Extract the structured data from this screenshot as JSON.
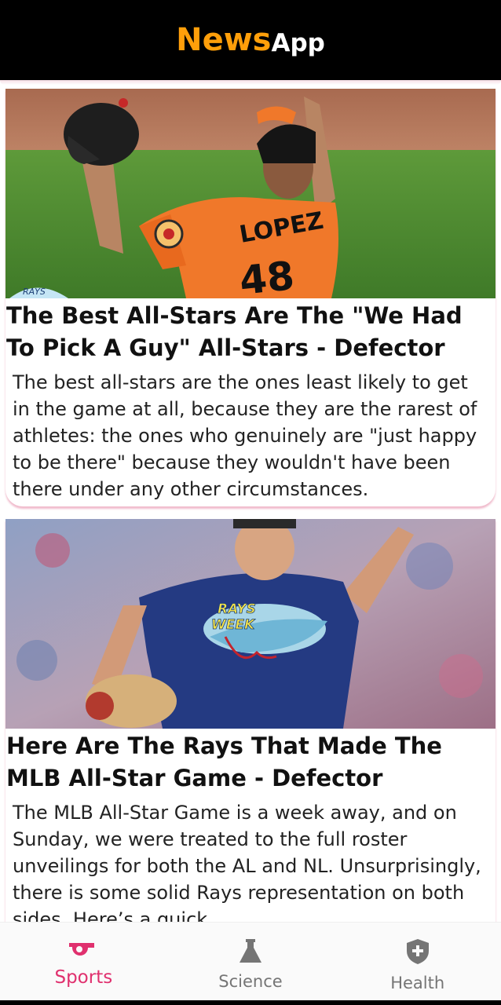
{
  "app": {
    "brand_main": "News",
    "brand_sub": "App"
  },
  "colors": {
    "accent": "#e0306e",
    "brand_orange": "#ff9f0a",
    "inactive": "#757575",
    "appbar": "#000000"
  },
  "articles": [
    {
      "title": "The Best All-Stars Are The \"We Had To Pick A Guy\" All-Stars - Defector",
      "description": "The best all-stars are the ones least likely to get in the game at all, because they are the rarest of athletes: the ones who genuinely are \"just happy to be there\" because they wouldn't have been there under any other circumstances.",
      "image": {
        "jersey_name": "LOPEZ",
        "jersey_number": "48",
        "badge_text": "RAYS WEEK"
      }
    },
    {
      "title": "Here Are The Rays That Made The MLB All-Star Game - Defector",
      "description": "The MLB All-Star Game is a week away, and on Sunday, we were treated to the full roster unveilings for both the AL and NL. Unsurprisingly, there is some solid Rays representation on both sides. Here’s a quick",
      "image": {
        "logo_line1": "RAYS",
        "logo_line2": "WEEK"
      }
    }
  ],
  "bottom_nav": {
    "items": [
      {
        "label": "Sports",
        "icon": "whistle-icon",
        "active": true
      },
      {
        "label": "Science",
        "icon": "flask-icon",
        "active": false
      },
      {
        "label": "Health",
        "icon": "shield-plus-icon",
        "active": false
      }
    ]
  }
}
